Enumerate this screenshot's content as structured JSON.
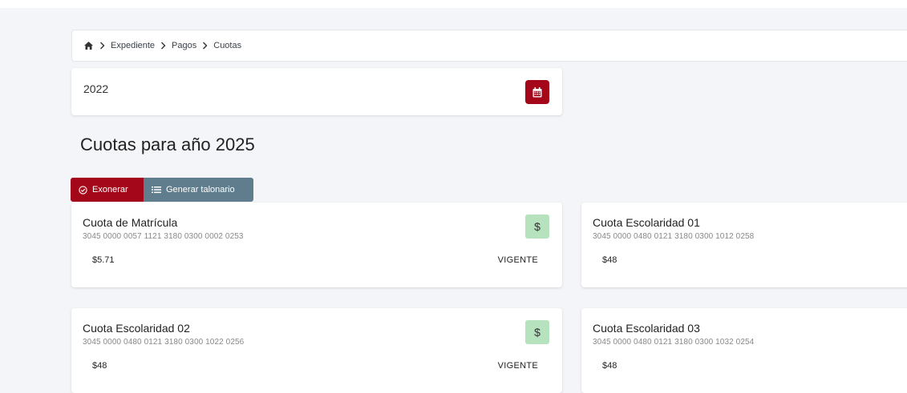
{
  "breadcrumb": {
    "items": [
      "Expediente",
      "Pagos",
      "Cuotas"
    ]
  },
  "year_selector": {
    "value": "2022"
  },
  "page": {
    "title": "Cuotas para año 2025"
  },
  "actions": {
    "exonerar_label": "Exonerar",
    "talonario_label": "Generar talonario"
  },
  "cuotas": [
    {
      "title": "Cuota de Matrícula",
      "code": "3045 0000 0057 1121 3180 0300 0002 0253",
      "amount": "$5.71",
      "status": "VIGENTE"
    },
    {
      "title": "Cuota Escolaridad 01",
      "code": "3045 0000 0480 0121 3180 0300 1012 0258",
      "amount": "$48",
      "status": ""
    },
    {
      "title": "Cuota Escolaridad 02",
      "code": "3045 0000 0480 0121 3180 0300 1022 0256",
      "amount": "$48",
      "status": "VIGENTE"
    },
    {
      "title": "Cuota Escolaridad 03",
      "code": "3045 0000 0480 0121 3180 0300 1032 0254",
      "amount": "$48",
      "status": ""
    }
  ],
  "pay_button": {
    "symbol": "$"
  },
  "colors": {
    "primary": "#a5071a",
    "secondary": "#5f7d8c",
    "pay_button": "#b6e2bd",
    "background": "#f4f5f8"
  }
}
